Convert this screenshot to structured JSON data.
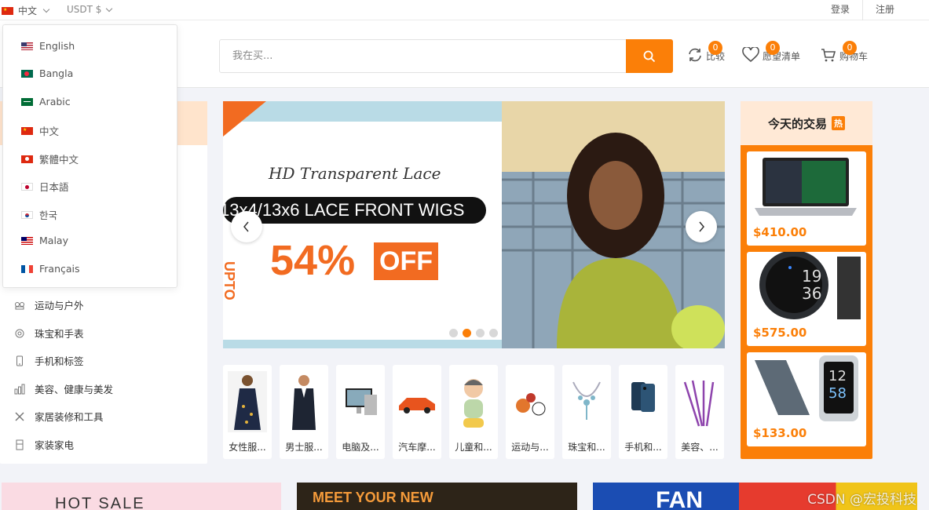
{
  "topbar": {
    "language": "中文",
    "currency": "USDT $",
    "login": "登录",
    "register": "注册"
  },
  "search": {
    "placeholder": "我在买..."
  },
  "header_actions": [
    {
      "label": "比较",
      "count": "0",
      "icon": "compare-icon"
    },
    {
      "label": "愿望清单",
      "count": "0",
      "icon": "heart-icon"
    },
    {
      "label": "购物车",
      "count": "0",
      "icon": "cart-icon"
    }
  ],
  "languages": [
    {
      "label": "English",
      "flag": "us"
    },
    {
      "label": "Bangla",
      "flag": "bd"
    },
    {
      "label": "Arabic",
      "flag": "sa"
    },
    {
      "label": "中文",
      "flag": "cn"
    },
    {
      "label": "繁體中文",
      "flag": "hk"
    },
    {
      "label": "日本語",
      "flag": "jp"
    },
    {
      "label": "한국",
      "flag": "kr"
    },
    {
      "label": "Malay",
      "flag": "my"
    },
    {
      "label": "Français",
      "flag": "fr"
    }
  ],
  "categories": [
    {
      "label": "运动与户外",
      "icon": "sports-icon"
    },
    {
      "label": "珠宝和手表",
      "icon": "jewelry-icon"
    },
    {
      "label": "手机和标签",
      "icon": "phone-icon"
    },
    {
      "label": "美容、健康与美发",
      "icon": "beauty-icon"
    },
    {
      "label": "家居装修和工具",
      "icon": "tools-icon"
    },
    {
      "label": "家装家电",
      "icon": "appliance-icon"
    }
  ],
  "banner": {
    "line1": "HD Transparent Lace",
    "line2": "13x4/13x6 LACE FRONT WIGS",
    "upto": "UPTO",
    "percent": "54%",
    "off": "OFF",
    "active_slide": 2,
    "slides": 4
  },
  "thumbs": [
    {
      "label": "女性服...",
      "icon": "dress-icon"
    },
    {
      "label": "男士服...",
      "icon": "suit-icon"
    },
    {
      "label": "电脑及...",
      "icon": "computer-icon"
    },
    {
      "label": "汽车摩...",
      "icon": "car-icon"
    },
    {
      "label": "儿童和...",
      "icon": "toy-icon"
    },
    {
      "label": "运动与...",
      "icon": "ball-icon"
    },
    {
      "label": "珠宝和...",
      "icon": "necklace-icon"
    },
    {
      "label": "手机和...",
      "icon": "smartphone-icon"
    },
    {
      "label": "美容、...",
      "icon": "brushes-icon"
    }
  ],
  "deals": {
    "title": "今天的交易",
    "hot": "热",
    "items": [
      {
        "price": "$410.00",
        "icon": "laptop-icon"
      },
      {
        "price": "$575.00",
        "icon": "watch-icon"
      },
      {
        "price": "$133.00",
        "icon": "fitness-band-icon"
      }
    ]
  },
  "bottom_banners": {
    "left": "HOT SALE",
    "middle": "MEET YOUR NEW",
    "right": "FAN"
  },
  "watermark": "CSDN @宏投科技",
  "colors": {
    "accent": "#fb7f08"
  }
}
